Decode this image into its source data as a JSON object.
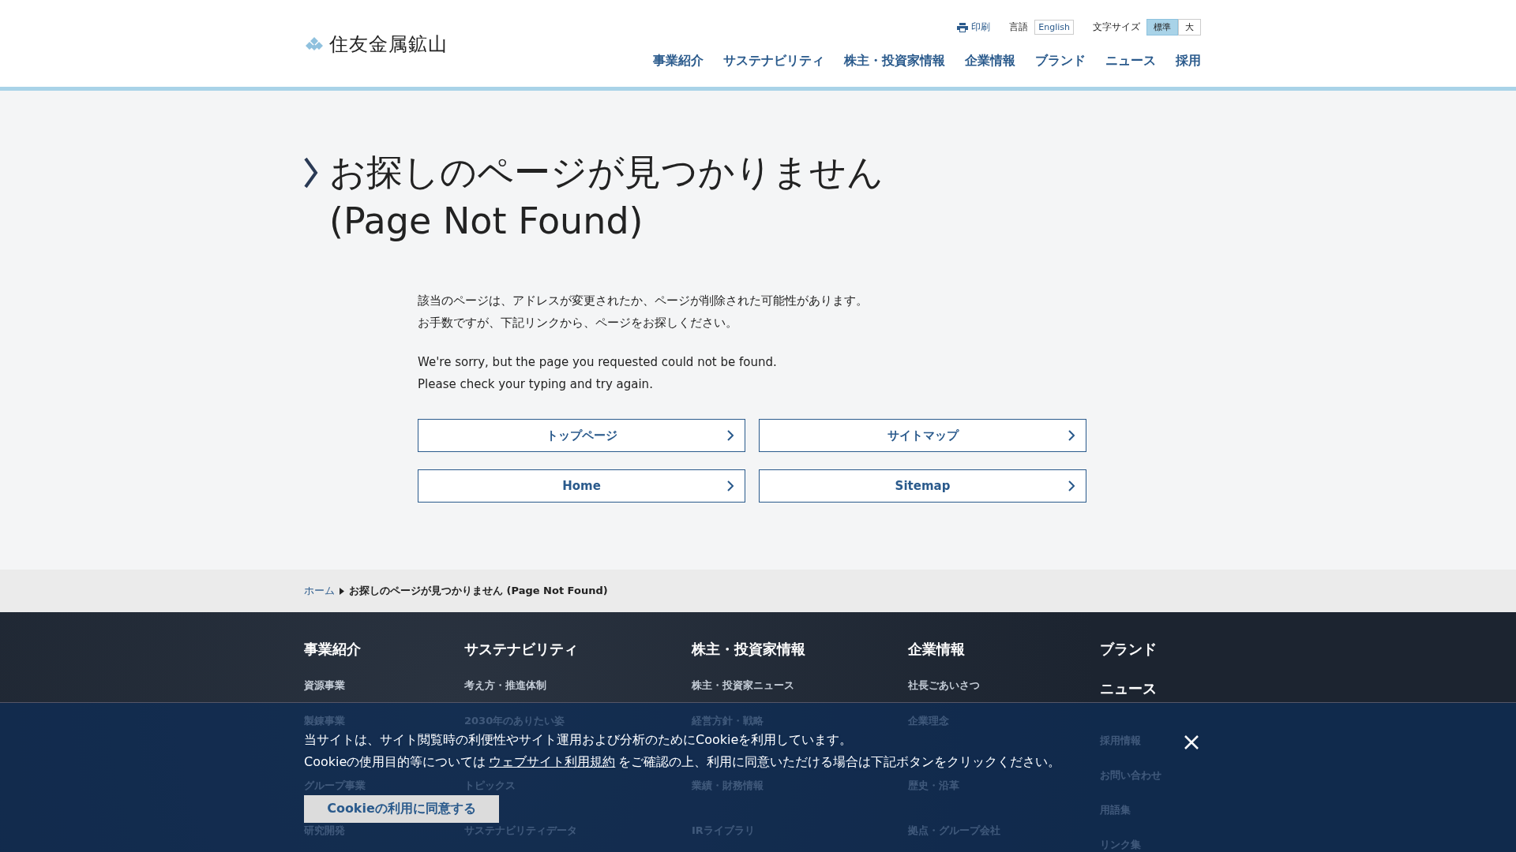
{
  "header": {
    "logo_text": "住友金属鉱山",
    "print": "印刷",
    "language_label": "言語",
    "language_link": "English",
    "font_size_label": "文字サイズ",
    "font_sizes": [
      {
        "label": "標準",
        "selected": true
      },
      {
        "label": "大",
        "selected": false
      }
    ],
    "nav": [
      "事業紹介",
      "サステナビリティ",
      "株主・投資家情報",
      "企業情報",
      "ブランド",
      "ニュース",
      "採用"
    ]
  },
  "main": {
    "title_lines": [
      "お探しのページが見つかりません",
      "(Page Not Found)"
    ],
    "paragraphs": [
      [
        "該当のページは、アドレスが変更されたか、ページが削除された可能性があります。",
        "お手数ですが、下記リンクから、ページをお探しください。"
      ],
      [
        "We're sorry, but the page you requested could not be found.",
        "Please check your typing and try again."
      ]
    ],
    "buttons": [
      "トップページ",
      "サイトマップ",
      "Home",
      "Sitemap"
    ]
  },
  "breadcrumb": [
    {
      "label": "ホーム",
      "kind": "link"
    },
    {
      "label": "お探しのページが見つかりません (Page Not Found)",
      "kind": "current"
    }
  ],
  "footer": {
    "columns": [
      {
        "headings": [
          "事業紹介"
        ],
        "items": [
          "資源事業",
          "製錬事業",
          "グループ事業",
          "研究開発"
        ]
      },
      {
        "headings": [
          "サステナビリティ"
        ],
        "items": [
          "考え方・推進体制",
          "2030年のありたい姿",
          "トピックス",
          "サステナビリティデータ"
        ]
      },
      {
        "headings": [
          "株主・投資家情報"
        ],
        "items": [
          "株主・投資家ニュース",
          "経営方針・戦略",
          "業績・財務情報",
          "IRライブラリ"
        ]
      },
      {
        "headings": [
          "企業情報"
        ],
        "items": [
          "社長ごあいさつ",
          "企業理念",
          "歴史・沿革",
          "拠点・グループ会社"
        ]
      },
      {
        "headings": [
          "ブランド",
          "ニュース"
        ],
        "items": [
          "採用情報",
          "お問い合わせ",
          "用語集",
          "リンク集"
        ]
      }
    ]
  },
  "cookie_banner": {
    "line1": "当サイトは、サイト閲覧時の利便性やサイト運用および分析のためにCookieを利用しています。",
    "line2_before": "Cookieの使用目的等については",
    "link": "ウェブサイト利用規約",
    "line2_after": "をご確認の上、利用に同意いただける場合は下記ボタンをクリックください。",
    "button": "Cookieの利用に同意する"
  }
}
